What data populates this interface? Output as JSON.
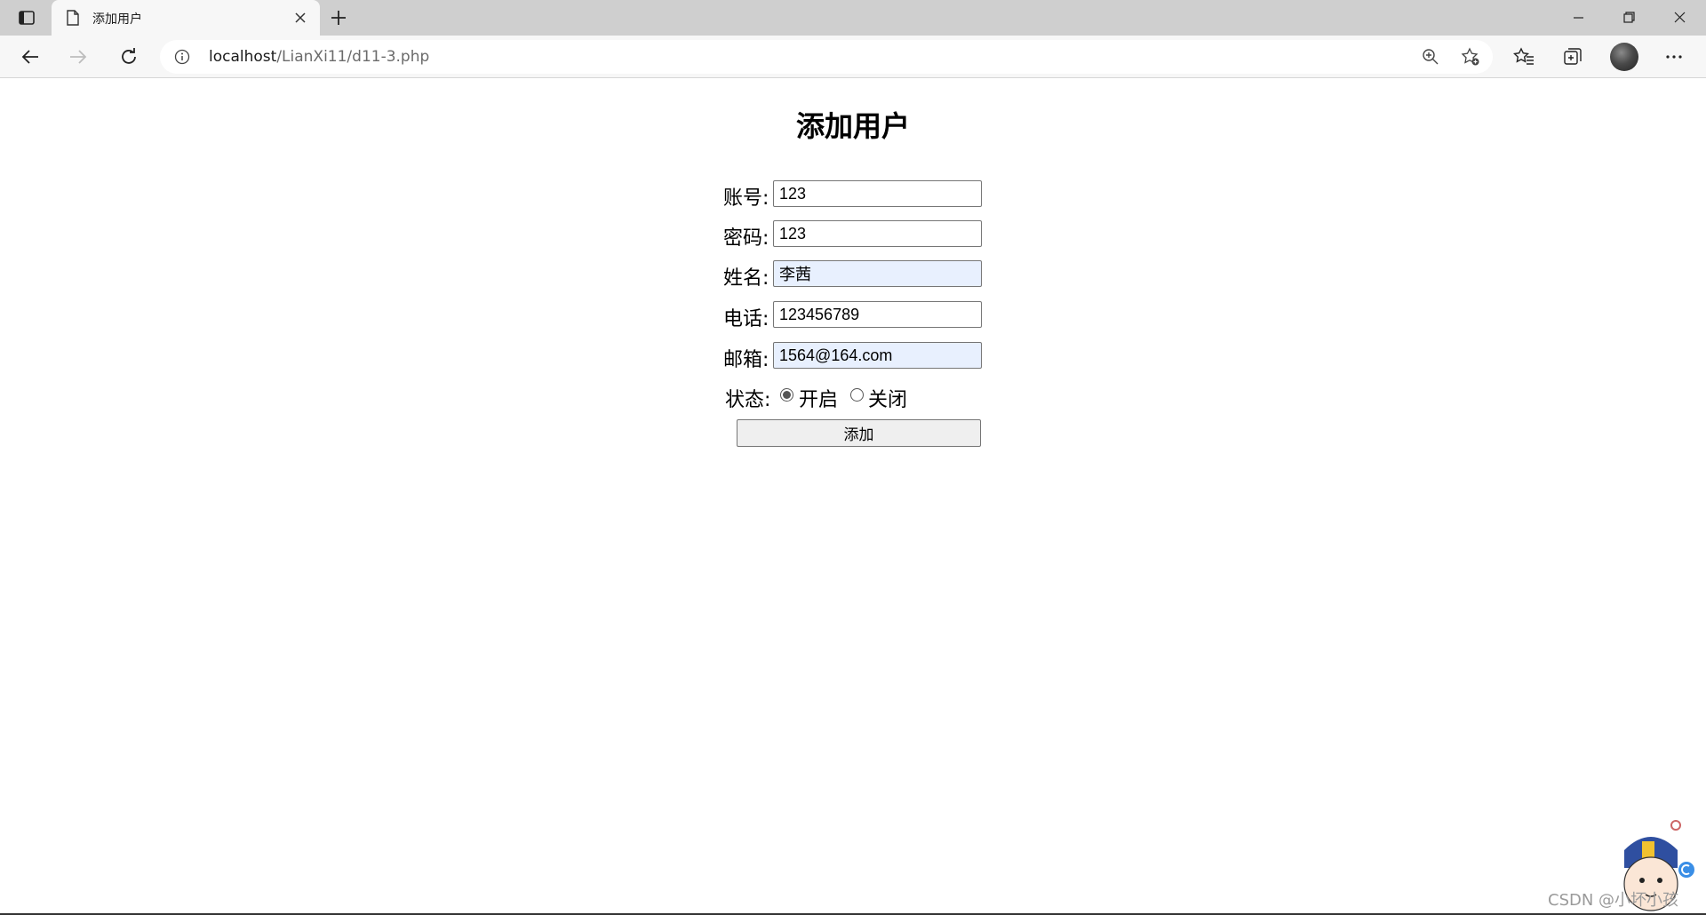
{
  "browser": {
    "tab_title": "添加用户",
    "url_host": "localhost",
    "url_path": "/LianXi11/d11-3.php"
  },
  "page": {
    "title": "添加用户",
    "fields": {
      "account": {
        "label": "账号:",
        "value": "123"
      },
      "password": {
        "label": "密码:",
        "value": "123"
      },
      "name": {
        "label": "姓名:",
        "value": "李茜"
      },
      "phone": {
        "label": "电话:",
        "value": "123456789"
      },
      "email": {
        "label": "邮箱:",
        "value": "1564@164.com"
      }
    },
    "status": {
      "label": "状态:",
      "options": [
        "开启",
        "关闭"
      ],
      "selected": "开启"
    },
    "submit_label": "添加"
  },
  "watermark": "CSDN @小坏小孩",
  "icons": {
    "tab_actions": "tab-actions-icon",
    "document": "document-icon",
    "close": "close-icon",
    "new_tab": "plus-icon",
    "back": "arrow-left-icon",
    "forward": "arrow-right-icon",
    "reload": "reload-icon",
    "info": "info-icon",
    "zoom": "zoom-in-icon",
    "add_favorite": "star-plus-icon",
    "favorites": "favorites-icon",
    "collections": "collections-icon",
    "more": "ellipsis-icon"
  }
}
